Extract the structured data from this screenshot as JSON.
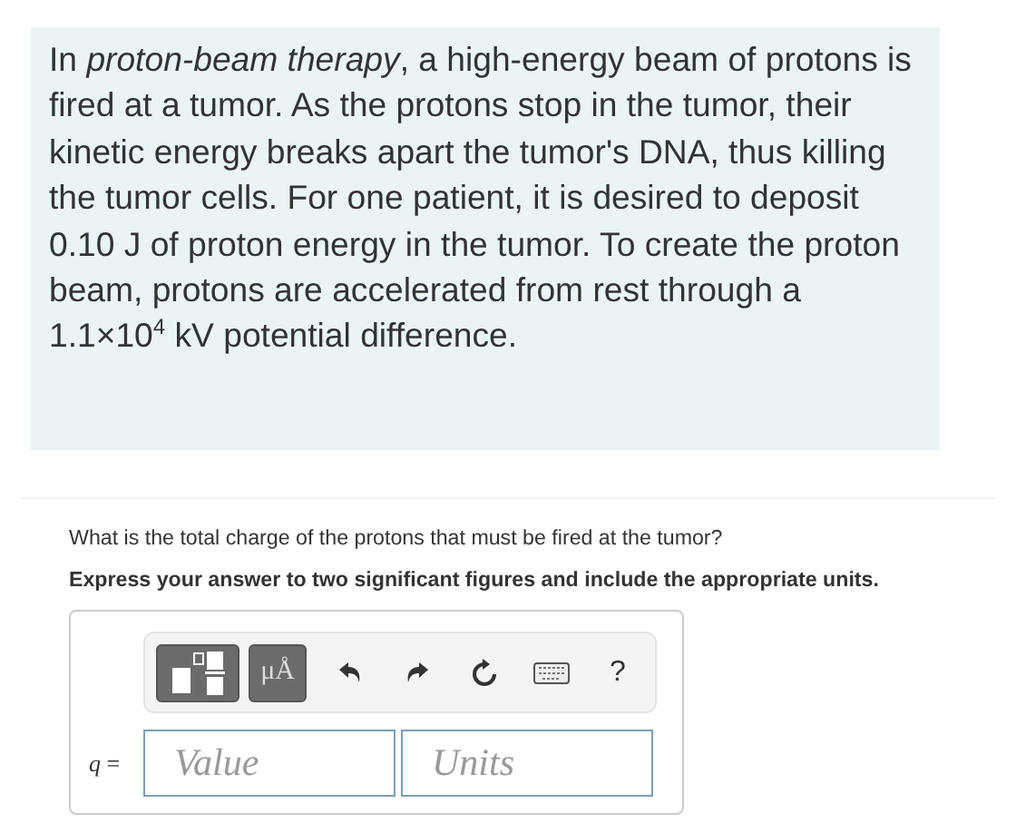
{
  "problem": {
    "text": "In *proton-beam therapy*, a high-energy beam of protons is fired at a tumor. As the protons stop in the tumor, their kinetic energy breaks apart the tumor's DNA, thus killing the tumor cells. For one patient, it is desired to deposit 0.10 J of proton energy in the tumor. To create the proton beam, protons are accelerated from rest through a 1.1×10$^{4}$ kV potential difference."
  },
  "question": "What is the total charge of the protons that must be fired at the tumor?",
  "instruction": "Express your answer to two significant figures and include the appropriate units.",
  "toolbar": [
    {
      "kind": "templates"
    },
    {
      "kind": "symbols",
      "label": "μÅ"
    },
    {
      "kind": "undo"
    },
    {
      "kind": "redo"
    },
    {
      "kind": "reset"
    },
    {
      "kind": "keyboard"
    },
    {
      "kind": "help",
      "label": "?"
    }
  ],
  "answer": {
    "label": "*q* =",
    "value_placeholder": "Value",
    "units_placeholder": "Units"
  }
}
